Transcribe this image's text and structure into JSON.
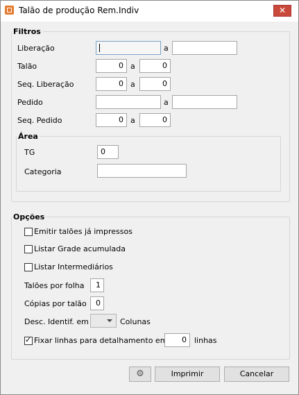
{
  "window": {
    "title": "Talão de produção Rem.Indiv",
    "close_glyph": "✕"
  },
  "filtros": {
    "legend": "Filtros",
    "a_label": "a",
    "liberacao": {
      "label": "Liberação",
      "from": "",
      "to": ""
    },
    "talao": {
      "label": "Talão",
      "from": "0",
      "to": "0"
    },
    "seq_liberacao": {
      "label": "Seq. Liberação",
      "from": "0",
      "to": "0"
    },
    "pedido": {
      "label": "Pedido",
      "from": "",
      "to": ""
    },
    "seq_pedido": {
      "label": "Seq. Pedido",
      "from": "0",
      "to": "0"
    },
    "area": {
      "legend": "Área",
      "tg": {
        "label": "TG",
        "value": "0"
      },
      "categoria": {
        "label": "Categoria",
        "value": ""
      }
    }
  },
  "opcoes": {
    "legend": "Opções",
    "emitir": {
      "label": "Emitir talões já impressos",
      "checked": false
    },
    "grade": {
      "label": "Listar Grade acumulada",
      "checked": false
    },
    "intermediarios": {
      "label": "Listar Intermediários",
      "checked": false
    },
    "taloes_por_folha": {
      "label": "Talões por folha",
      "value": "1"
    },
    "copias_por_talao": {
      "label": "Cópias por talão",
      "value": "0"
    },
    "desc_identif": {
      "label": "Desc. Identif. em",
      "value": "",
      "suffix": "Colunas"
    },
    "fixar_linhas": {
      "label": "Fixar linhas para detalhamento em:",
      "checked": true,
      "value": "0",
      "suffix": "linhas"
    }
  },
  "buttons": {
    "settings_icon": "gear-icon",
    "imprimir": "Imprimir",
    "cancelar": "Cancelar"
  }
}
